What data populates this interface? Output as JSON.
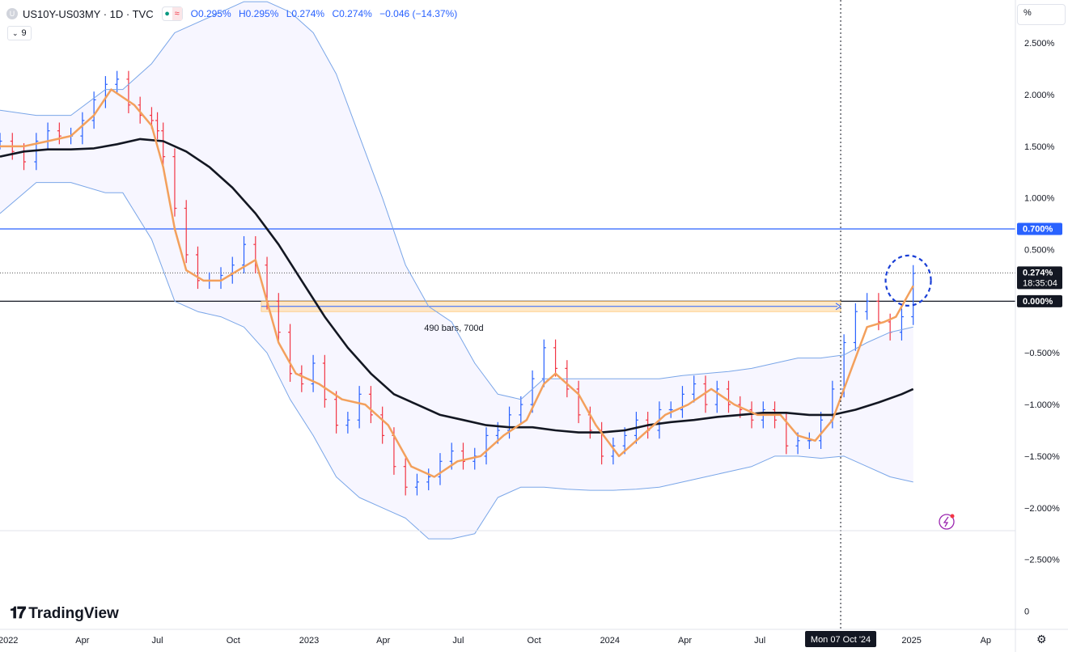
{
  "header": {
    "symbol": "US10Y-US03MY · 1D · TVC",
    "ohlc": [
      "O0.295%",
      "H0.295%",
      "L0.274%",
      "C0.274%",
      "−0.046 (−14.37%)"
    ],
    "indicator_count": "9",
    "symbol_icon": "circle-icon",
    "status_icons": [
      "dot-icon",
      "wave-icon"
    ]
  },
  "axis_unit": "%",
  "brand": "TradingView",
  "chart_data": {
    "type": "line",
    "title": "",
    "x_axis": {
      "range": [
        "2021-12-22",
        "2025-05-07"
      ],
      "ticks": [
        {
          "label": "2022",
          "date": "2022-01-01"
        },
        {
          "label": "Apr",
          "date": "2022-04-01"
        },
        {
          "label": "Jul",
          "date": "2022-07-01"
        },
        {
          "label": "Oct",
          "date": "2022-10-01"
        },
        {
          "label": "2023",
          "date": "2023-01-01"
        },
        {
          "label": "Apr",
          "date": "2023-04-01"
        },
        {
          "label": "Jul",
          "date": "2023-07-01"
        },
        {
          "label": "Oct",
          "date": "2023-10-01"
        },
        {
          "label": "2024",
          "date": "2024-01-01"
        },
        {
          "label": "Apr",
          "date": "2024-04-01"
        },
        {
          "label": "Jul",
          "date": "2024-07-01"
        },
        {
          "label": "2025",
          "date": "2025-01-01"
        },
        {
          "label": "Ap",
          "date": "2025-04-01"
        }
      ]
    },
    "y_axis": {
      "unit": "%",
      "range": [
        -3.2,
        2.85
      ],
      "ticks": [
        {
          "label": "2.500%",
          "value": 2.5
        },
        {
          "label": "2.000%",
          "value": 2.0
        },
        {
          "label": "1.500%",
          "value": 1.5
        },
        {
          "label": "1.000%",
          "value": 1.0
        },
        {
          "label": "0.500%",
          "value": 0.5
        },
        {
          "label": "−0.500%",
          "value": -0.5
        },
        {
          "label": "−1.000%",
          "value": -1.0
        },
        {
          "label": "−1.500%",
          "value": -1.5
        },
        {
          "label": "−2.000%",
          "value": -2.0
        },
        {
          "label": "−2.500%",
          "value": -2.5
        },
        {
          "label": "0",
          "value": -3.0
        }
      ]
    },
    "price_labels": [
      {
        "label": "0.700%",
        "value": 0.7,
        "color": "#2962ff"
      },
      {
        "label": "0.274%",
        "sublabel": "18:35:04",
        "value": 0.274,
        "color": "#131722"
      },
      {
        "label": "0.000%",
        "value": 0.0,
        "color": "#131722"
      }
    ],
    "horizontal_lines": [
      {
        "value": 0.7,
        "color": "#2962ff"
      },
      {
        "value": 0.0,
        "color": "#131722"
      }
    ],
    "crosshair": {
      "date": "2024-10-07",
      "label": "Mon 07 Oct '24"
    },
    "annotation": {
      "text": "490 bars, 700d",
      "from": "2022-11-04",
      "to": "2024-10-07",
      "value_from": -0.1,
      "value_to": 0.0
    },
    "highlight_circle": {
      "date": "2024-12-28",
      "value": 0.2
    },
    "series": [
      {
        "type": "bars",
        "color_up": "#2962ff",
        "color_down": "#f23645",
        "x": [
          "2021-12-22",
          "2022-01-06",
          "2022-01-20",
          "2022-02-04",
          "2022-02-18",
          "2022-03-04",
          "2022-03-18",
          "2022-04-01",
          "2022-04-15",
          "2022-04-29",
          "2022-05-13",
          "2022-05-27",
          "2022-06-10",
          "2022-06-24",
          "2022-07-01",
          "2022-07-08",
          "2022-07-22",
          "2022-08-05",
          "2022-08-19",
          "2022-09-02",
          "2022-09-16",
          "2022-09-30",
          "2022-10-14",
          "2022-10-28",
          "2022-11-11",
          "2022-11-25",
          "2022-12-09",
          "2022-12-23",
          "2023-01-06",
          "2023-01-20",
          "2023-02-03",
          "2023-02-17",
          "2023-03-03",
          "2023-03-17",
          "2023-03-31",
          "2023-04-14",
          "2023-04-28",
          "2023-05-12",
          "2023-05-26",
          "2023-06-09",
          "2023-06-23",
          "2023-07-07",
          "2023-07-21",
          "2023-08-04",
          "2023-08-18",
          "2023-09-01",
          "2023-09-15",
          "2023-09-29",
          "2023-10-13",
          "2023-10-27",
          "2023-11-10",
          "2023-11-24",
          "2023-12-08",
          "2023-12-22",
          "2024-01-05",
          "2024-01-19",
          "2024-02-02",
          "2024-02-16",
          "2024-03-01",
          "2024-03-15",
          "2024-03-29",
          "2024-04-12",
          "2024-04-26",
          "2024-05-10",
          "2024-05-24",
          "2024-06-07",
          "2024-06-21",
          "2024-07-05",
          "2024-07-19",
          "2024-08-02",
          "2024-08-16",
          "2024-08-30",
          "2024-09-13",
          "2024-09-27",
          "2024-10-11",
          "2024-10-25",
          "2024-11-08",
          "2024-11-22",
          "2024-12-06",
          "2024-12-20",
          "2025-01-03"
        ],
        "values": [
          1.55,
          1.45,
          1.35,
          1.55,
          1.65,
          1.6,
          1.6,
          1.75,
          1.95,
          2.1,
          2.15,
          1.9,
          1.8,
          1.75,
          1.65,
          1.4,
          0.9,
          0.45,
          0.2,
          0.2,
          0.25,
          0.35,
          0.55,
          0.35,
          0.0,
          -0.3,
          -0.7,
          -0.8,
          -0.6,
          -0.95,
          -1.2,
          -1.15,
          -0.9,
          -1.1,
          -1.3,
          -1.6,
          -1.8,
          -1.75,
          -1.7,
          -1.55,
          -1.45,
          -1.55,
          -1.5,
          -1.3,
          -1.25,
          -1.1,
          -1.0,
          -0.75,
          -0.45,
          -0.65,
          -0.85,
          -1.1,
          -1.25,
          -1.5,
          -1.4,
          -1.3,
          -1.15,
          -1.25,
          -1.05,
          -1.05,
          -0.9,
          -0.8,
          -1.0,
          -0.85,
          -1.0,
          -1.05,
          -1.15,
          -1.05,
          -1.15,
          -1.4,
          -1.35,
          -1.35,
          -1.15,
          -0.85,
          -0.4,
          -0.1,
          0.0,
          -0.2,
          -0.3,
          -0.15,
          0.27
        ]
      },
      {
        "type": "line",
        "color": "#f3a05c",
        "x": [
          "2021-12-22",
          "2022-01-20",
          "2022-02-18",
          "2022-03-18",
          "2022-04-15",
          "2022-05-06",
          "2022-06-03",
          "2022-06-24",
          "2022-07-08",
          "2022-07-22",
          "2022-08-05",
          "2022-08-26",
          "2022-09-16",
          "2022-10-07",
          "2022-10-28",
          "2022-11-11",
          "2022-11-25",
          "2022-12-16",
          "2023-01-13",
          "2023-02-10",
          "2023-03-10",
          "2023-04-07",
          "2023-05-05",
          "2023-06-02",
          "2023-06-30",
          "2023-07-28",
          "2023-08-25",
          "2023-09-22",
          "2023-10-13",
          "2023-10-27",
          "2023-11-24",
          "2023-12-15",
          "2024-01-12",
          "2024-02-09",
          "2024-03-08",
          "2024-04-05",
          "2024-05-03",
          "2024-05-31",
          "2024-06-28",
          "2024-07-26",
          "2024-08-16",
          "2024-09-06",
          "2024-09-27",
          "2024-10-18",
          "2024-11-08",
          "2024-11-29",
          "2024-12-13",
          "2025-01-03"
        ],
        "values": [
          1.5,
          1.5,
          1.55,
          1.6,
          1.8,
          2.05,
          1.9,
          1.7,
          1.3,
          0.7,
          0.3,
          0.2,
          0.2,
          0.3,
          0.4,
          0.0,
          -0.4,
          -0.7,
          -0.8,
          -0.95,
          -1.0,
          -1.2,
          -1.6,
          -1.7,
          -1.55,
          -1.5,
          -1.3,
          -1.15,
          -0.8,
          -0.7,
          -0.9,
          -1.2,
          -1.5,
          -1.3,
          -1.1,
          -1.0,
          -0.85,
          -1.0,
          -1.1,
          -1.1,
          -1.3,
          -1.35,
          -1.15,
          -0.7,
          -0.25,
          -0.2,
          -0.15,
          0.15
        ]
      },
      {
        "type": "line",
        "color": "#131722",
        "x": [
          "2021-12-22",
          "2022-01-20",
          "2022-02-18",
          "2022-03-18",
          "2022-04-15",
          "2022-05-13",
          "2022-06-10",
          "2022-07-08",
          "2022-08-05",
          "2022-09-02",
          "2022-09-30",
          "2022-10-28",
          "2022-11-25",
          "2022-12-23",
          "2023-01-20",
          "2023-02-17",
          "2023-03-17",
          "2023-04-14",
          "2023-05-12",
          "2023-06-09",
          "2023-07-07",
          "2023-08-04",
          "2023-09-01",
          "2023-09-29",
          "2023-10-27",
          "2023-11-24",
          "2023-12-22",
          "2024-01-19",
          "2024-02-16",
          "2024-03-15",
          "2024-04-12",
          "2024-05-10",
          "2024-06-07",
          "2024-07-05",
          "2024-08-02",
          "2024-08-30",
          "2024-09-27",
          "2024-10-25",
          "2024-11-22",
          "2024-12-20",
          "2025-01-03"
        ],
        "values": [
          1.4,
          1.45,
          1.47,
          1.47,
          1.48,
          1.52,
          1.57,
          1.55,
          1.45,
          1.3,
          1.1,
          0.85,
          0.55,
          0.2,
          -0.15,
          -0.45,
          -0.7,
          -0.9,
          -1.0,
          -1.1,
          -1.15,
          -1.2,
          -1.22,
          -1.22,
          -1.25,
          -1.27,
          -1.27,
          -1.25,
          -1.2,
          -1.17,
          -1.15,
          -1.12,
          -1.1,
          -1.08,
          -1.08,
          -1.1,
          -1.1,
          -1.05,
          -0.98,
          -0.9,
          -0.85
        ]
      },
      {
        "type": "line",
        "color": "#7aa6e8",
        "x": [
          "2021-12-22",
          "2022-02-04",
          "2022-03-18",
          "2022-04-29",
          "2022-05-20",
          "2022-06-24",
          "2022-07-22",
          "2022-08-19",
          "2022-09-16",
          "2022-10-14",
          "2022-11-11",
          "2022-12-09",
          "2023-01-06",
          "2023-02-03",
          "2023-03-03",
          "2023-03-31",
          "2023-04-28",
          "2023-05-26",
          "2023-06-23",
          "2023-07-21",
          "2023-08-18",
          "2023-09-15",
          "2023-10-13",
          "2023-11-10",
          "2023-12-08",
          "2024-01-05",
          "2024-02-02",
          "2024-03-01",
          "2024-03-29",
          "2024-04-26",
          "2024-05-24",
          "2024-06-21",
          "2024-07-19",
          "2024-08-16",
          "2024-09-13",
          "2024-10-11",
          "2024-11-08",
          "2024-12-06",
          "2025-01-03"
        ],
        "values": [
          1.85,
          1.8,
          1.8,
          2.05,
          2.05,
          2.3,
          2.6,
          2.7,
          2.8,
          2.9,
          2.9,
          2.8,
          2.6,
          2.2,
          1.6,
          1.0,
          0.35,
          -0.05,
          -0.2,
          -0.6,
          -0.9,
          -0.95,
          -0.75,
          -0.75,
          -0.75,
          -0.75,
          -0.75,
          -0.75,
          -0.72,
          -0.7,
          -0.68,
          -0.65,
          -0.6,
          -0.55,
          -0.55,
          -0.52,
          -0.4,
          -0.3,
          -0.25
        ]
      },
      {
        "type": "line",
        "color": "#7aa6e8",
        "x": [
          "2021-12-22",
          "2022-02-04",
          "2022-03-18",
          "2022-04-29",
          "2022-05-20",
          "2022-06-24",
          "2022-07-22",
          "2022-08-19",
          "2022-09-16",
          "2022-10-14",
          "2022-11-11",
          "2022-12-09",
          "2023-01-06",
          "2023-02-03",
          "2023-03-03",
          "2023-03-31",
          "2023-04-28",
          "2023-05-26",
          "2023-06-23",
          "2023-07-21",
          "2023-08-18",
          "2023-09-15",
          "2023-10-13",
          "2023-11-10",
          "2023-12-08",
          "2024-01-05",
          "2024-02-02",
          "2024-03-01",
          "2024-03-29",
          "2024-04-26",
          "2024-05-24",
          "2024-06-21",
          "2024-07-19",
          "2024-08-16",
          "2024-09-13",
          "2024-10-11",
          "2024-11-08",
          "2024-12-06",
          "2025-01-03"
        ],
        "values": [
          0.85,
          1.15,
          1.15,
          1.05,
          1.05,
          0.6,
          0.0,
          -0.1,
          -0.15,
          -0.25,
          -0.5,
          -0.95,
          -1.3,
          -1.7,
          -1.9,
          -2.0,
          -2.1,
          -2.3,
          -2.3,
          -2.25,
          -1.9,
          -1.8,
          -1.8,
          -1.82,
          -1.83,
          -1.83,
          -1.82,
          -1.8,
          -1.75,
          -1.7,
          -1.65,
          -1.6,
          -1.5,
          -1.5,
          -1.52,
          -1.5,
          -1.6,
          -1.7,
          -1.75
        ]
      }
    ]
  }
}
